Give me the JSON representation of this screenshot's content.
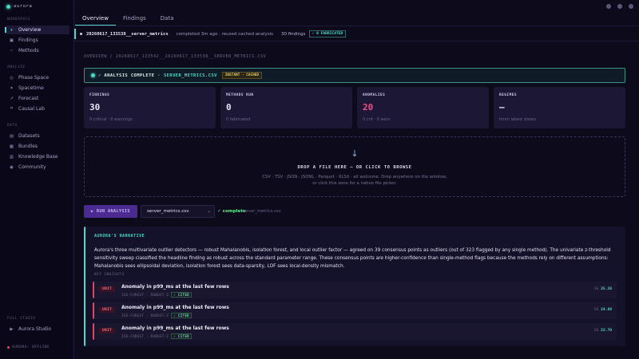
{
  "app": {
    "name": "aurora",
    "status": "AURORA: OFFLINE"
  },
  "sidebar": {
    "sections": {
      "workspace": "WORKSPACE",
      "analyze": "ANALYZE",
      "data": "DATA",
      "full_studio": "FULL STUDIO"
    },
    "items": [
      {
        "label": "Overview",
        "icon": "plus-icon",
        "glyph": "+"
      },
      {
        "label": "Findings",
        "icon": "flag-icon",
        "glyph": "▣"
      },
      {
        "label": "Methods",
        "icon": "tilde-icon",
        "glyph": "~"
      },
      {
        "label": "Phase Space",
        "icon": "phase-icon",
        "glyph": "◎"
      },
      {
        "label": "Spacetime",
        "icon": "spacetime-icon",
        "glyph": "✦"
      },
      {
        "label": "Forecast",
        "icon": "forecast-icon",
        "glyph": "↗"
      },
      {
        "label": "Causal Lab",
        "icon": "causal-icon",
        "glyph": "⌗"
      },
      {
        "label": "Datasets",
        "icon": "datasets-icon",
        "glyph": "▤"
      },
      {
        "label": "Bundles",
        "icon": "bundles-icon",
        "glyph": "▦"
      },
      {
        "label": "Knowledge Base",
        "icon": "book-icon",
        "glyph": "▥"
      },
      {
        "label": "Community",
        "icon": "globe-icon",
        "glyph": "◉"
      },
      {
        "label": "Aurora Studio",
        "icon": "play-icon",
        "glyph": "▶"
      }
    ]
  },
  "tabs": [
    "Overview",
    "Findings",
    "Data"
  ],
  "filebar": {
    "name": "20260617_133538__server_metrics",
    "status": "completed 3m ago · reused cached analysis",
    "findings": "30 findings",
    "badge": "✓ 0 FABRICATED"
  },
  "breadcrumb": "OVERVIEW / 20260617_133542__20260617_133538__SERVER_METRICS.CSV",
  "banner": {
    "text": "✓ ANALYSIS COMPLETE ·",
    "file": "SERVER_METRICS.CSV",
    "badge": "INSTANT · CACHED"
  },
  "stats": [
    {
      "label": "FINDINGS",
      "value": "30",
      "sub": "0 critical · 0 warnings",
      "color": "#e8e4f6"
    },
    {
      "label": "METHODS RUN",
      "value": "0",
      "sub": "0 fabricated",
      "color": "#e8e4f6"
    },
    {
      "label": "ANOMALIES",
      "value": "20",
      "sub": "0 crit · 0 warn",
      "color": "#f0508a"
    },
    {
      "label": "REGIMES",
      "value": "—",
      "sub": "hmm latent states",
      "color": "#e8e4f6"
    }
  ],
  "dropzone": {
    "arrow": "↓",
    "title": "DROP A FILE HERE — OR CLICK TO BROWSE",
    "description": "CSV · TSV · JSON · JSONL · Parquet · XLSX · all welcome. Drop anywhere on the window, or click this zone for a native file picker."
  },
  "run": {
    "button": "▶ RUN ANALYSIS",
    "selected_file": "server_metrics.csv",
    "status": "✓ complete",
    "status_file": "server_metrics.csv"
  },
  "narrative": {
    "title": "AURORA'S NARRATIVE",
    "body": "Aurora's three multivariate outlier detectors — robust Mahalanobis, isolation forest, and local outlier factor — agreed on 39 consensus points as outliers (out of 323 flagged by any single method). The univariate z-threshold sensitivity sweep classified the headline finding as robust across the standard parameter range. These consensus points are higher-confidence than single-method flags because the methods rely on different assumptions: Mahalanobis sees ellipsoidal deviation, isolation forest sees data-sparsity, LOF sees local-density mismatch.",
    "key_insights_label": "KEY INSIGHTS"
  },
  "insights": [
    {
      "unit": "UNIT",
      "title": "Anomaly in p99_ms at the last few rows",
      "meta": "ISO-FOREST · ROBUST-Z",
      "check": "✓ CITED",
      "score_label": "SS",
      "score": "25.20"
    },
    {
      "unit": "UNIT",
      "title": "Anomaly in p99_ms at the last few rows",
      "meta": "ISO-FOREST · ROBUST-Z",
      "check": "✓ CITED",
      "score_label": "SS",
      "score": "24.80"
    },
    {
      "unit": "UNIT",
      "title": "Anomaly in p99_ms at the last few rows",
      "meta": "ISO-FOREST · ROBUST-Z",
      "check": "✓ CITED",
      "score_label": "SS",
      "score": "23.70"
    }
  ]
}
